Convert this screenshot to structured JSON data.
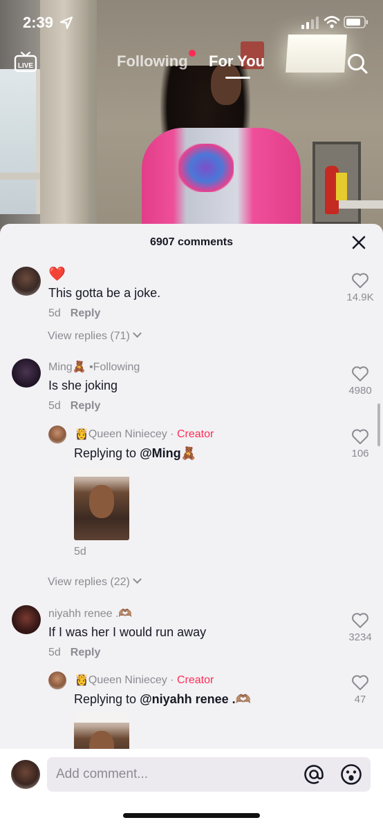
{
  "status_bar": {
    "time": "2:39"
  },
  "top_nav": {
    "live_label": "LIVE",
    "tabs": [
      {
        "label": "Following",
        "active": false,
        "has_dot": true
      },
      {
        "label": "For You",
        "active": true
      }
    ]
  },
  "comments_sheet": {
    "title": "6907 comments",
    "comments": [
      {
        "emoji": "❤️",
        "text": "This gotta be a joke.",
        "age": "5d",
        "reply_label": "Reply",
        "likes": "14.9K",
        "view_replies": "View replies (71)"
      },
      {
        "username": "Ming🧸",
        "following": "•Following",
        "text": "Is she joking",
        "age": "5d",
        "reply_label": "Reply",
        "likes": "4980",
        "reply": {
          "username": "👸Queen Niniecey",
          "separator": " · ",
          "badge": "Creator",
          "replying_prefix": "Replying to ",
          "replying_to": "@Ming🧸",
          "age": "5d",
          "likes": "106"
        },
        "view_replies": "View replies (22)"
      },
      {
        "username": "niyahh renee .🫶🏽",
        "text": "If I was her I would run away",
        "age": "5d",
        "reply_label": "Reply",
        "likes": "3234",
        "reply": {
          "username": "👸Queen Niniecey",
          "separator": " · ",
          "badge": "Creator",
          "replying_prefix": "Replying to ",
          "replying_to": "@niyahh renee .🫶🏽",
          "likes": "47"
        }
      }
    ]
  },
  "composer": {
    "placeholder": "Add comment..."
  },
  "colors": {
    "accent": "#fe2c55",
    "sheet_bg": "#f2f1f4",
    "muted_text": "#8a8b91",
    "primary_text": "#161823"
  },
  "icons": [
    "location-icon",
    "signal-icon",
    "wifi-icon",
    "battery-icon",
    "live-icon",
    "search-icon",
    "close-icon",
    "heart-icon",
    "chevron-down-icon",
    "at-icon",
    "emoji-icon"
  ]
}
